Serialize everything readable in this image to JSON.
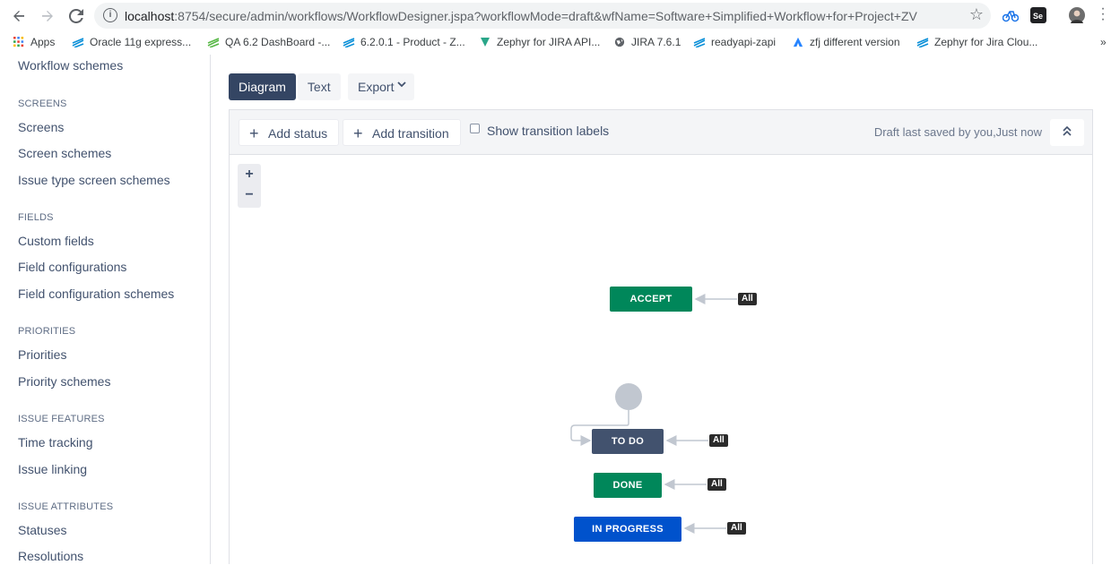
{
  "browser": {
    "url_host": "localhost",
    "url_path": ":8754/secure/admin/workflows/WorkflowDesigner.jspa?workflowMode=draft&wfName=Software+Simplified+Workflow+for+Project+ZV",
    "bookmarks": [
      {
        "label": "Apps",
        "icon": "apps-grid-icon"
      },
      {
        "label": "Oracle 11g express...",
        "icon": "zephyr-icon"
      },
      {
        "label": "QA 6.2 DashBoard -...",
        "icon": "zephyr-icon"
      },
      {
        "label": "6.2.0.1 - Product - Z...",
        "icon": "zephyr-icon"
      },
      {
        "label": "Zephyr for JIRA API...",
        "icon": "zephyr-leaf-icon"
      },
      {
        "label": "JIRA 7.6.1",
        "icon": "globe-icon"
      },
      {
        "label": "readyapi-zapi",
        "icon": "zephyr-icon"
      },
      {
        "label": "zfj different version",
        "icon": "atlassian-icon"
      },
      {
        "label": "Zephyr for Jira Clou...",
        "icon": "zephyr-icon"
      }
    ],
    "more": "»"
  },
  "sidebar": {
    "top_item": "Workflow schemes",
    "sections": [
      {
        "heading": "SCREENS",
        "items": [
          "Screens",
          "Screen schemes",
          "Issue type screen schemes"
        ]
      },
      {
        "heading": "FIELDS",
        "items": [
          "Custom fields",
          "Field configurations",
          "Field configuration schemes"
        ]
      },
      {
        "heading": "PRIORITIES",
        "items": [
          "Priorities",
          "Priority schemes"
        ]
      },
      {
        "heading": "ISSUE FEATURES",
        "items": [
          "Time tracking",
          "Issue linking"
        ]
      },
      {
        "heading": "ISSUE ATTRIBUTES",
        "items": [
          "Statuses",
          "Resolutions"
        ]
      }
    ]
  },
  "view": {
    "tab_diagram": "Diagram",
    "tab_text": "Text",
    "export": "Export"
  },
  "toolbar": {
    "add_status": "Add status",
    "add_transition": "Add transition",
    "show_labels": "Show transition labels",
    "saved_status": "Draft last saved by you,Just now"
  },
  "zoom": {
    "in": "+",
    "out": "−"
  },
  "diagram": {
    "statuses": [
      {
        "id": "accept",
        "label": "ACCEPT",
        "color": "#00875a"
      },
      {
        "id": "todo",
        "label": "TO DO",
        "color": "#42526e"
      },
      {
        "id": "done",
        "label": "DONE",
        "color": "#00875a"
      },
      {
        "id": "inprogress",
        "label": "IN PROGRESS",
        "color": "#0052cc"
      }
    ],
    "global_transition_label": "All"
  },
  "colors": {
    "tab_active": "#344563",
    "status_green": "#00875a",
    "status_blue": "#0052cc",
    "status_grey": "#42526e"
  }
}
